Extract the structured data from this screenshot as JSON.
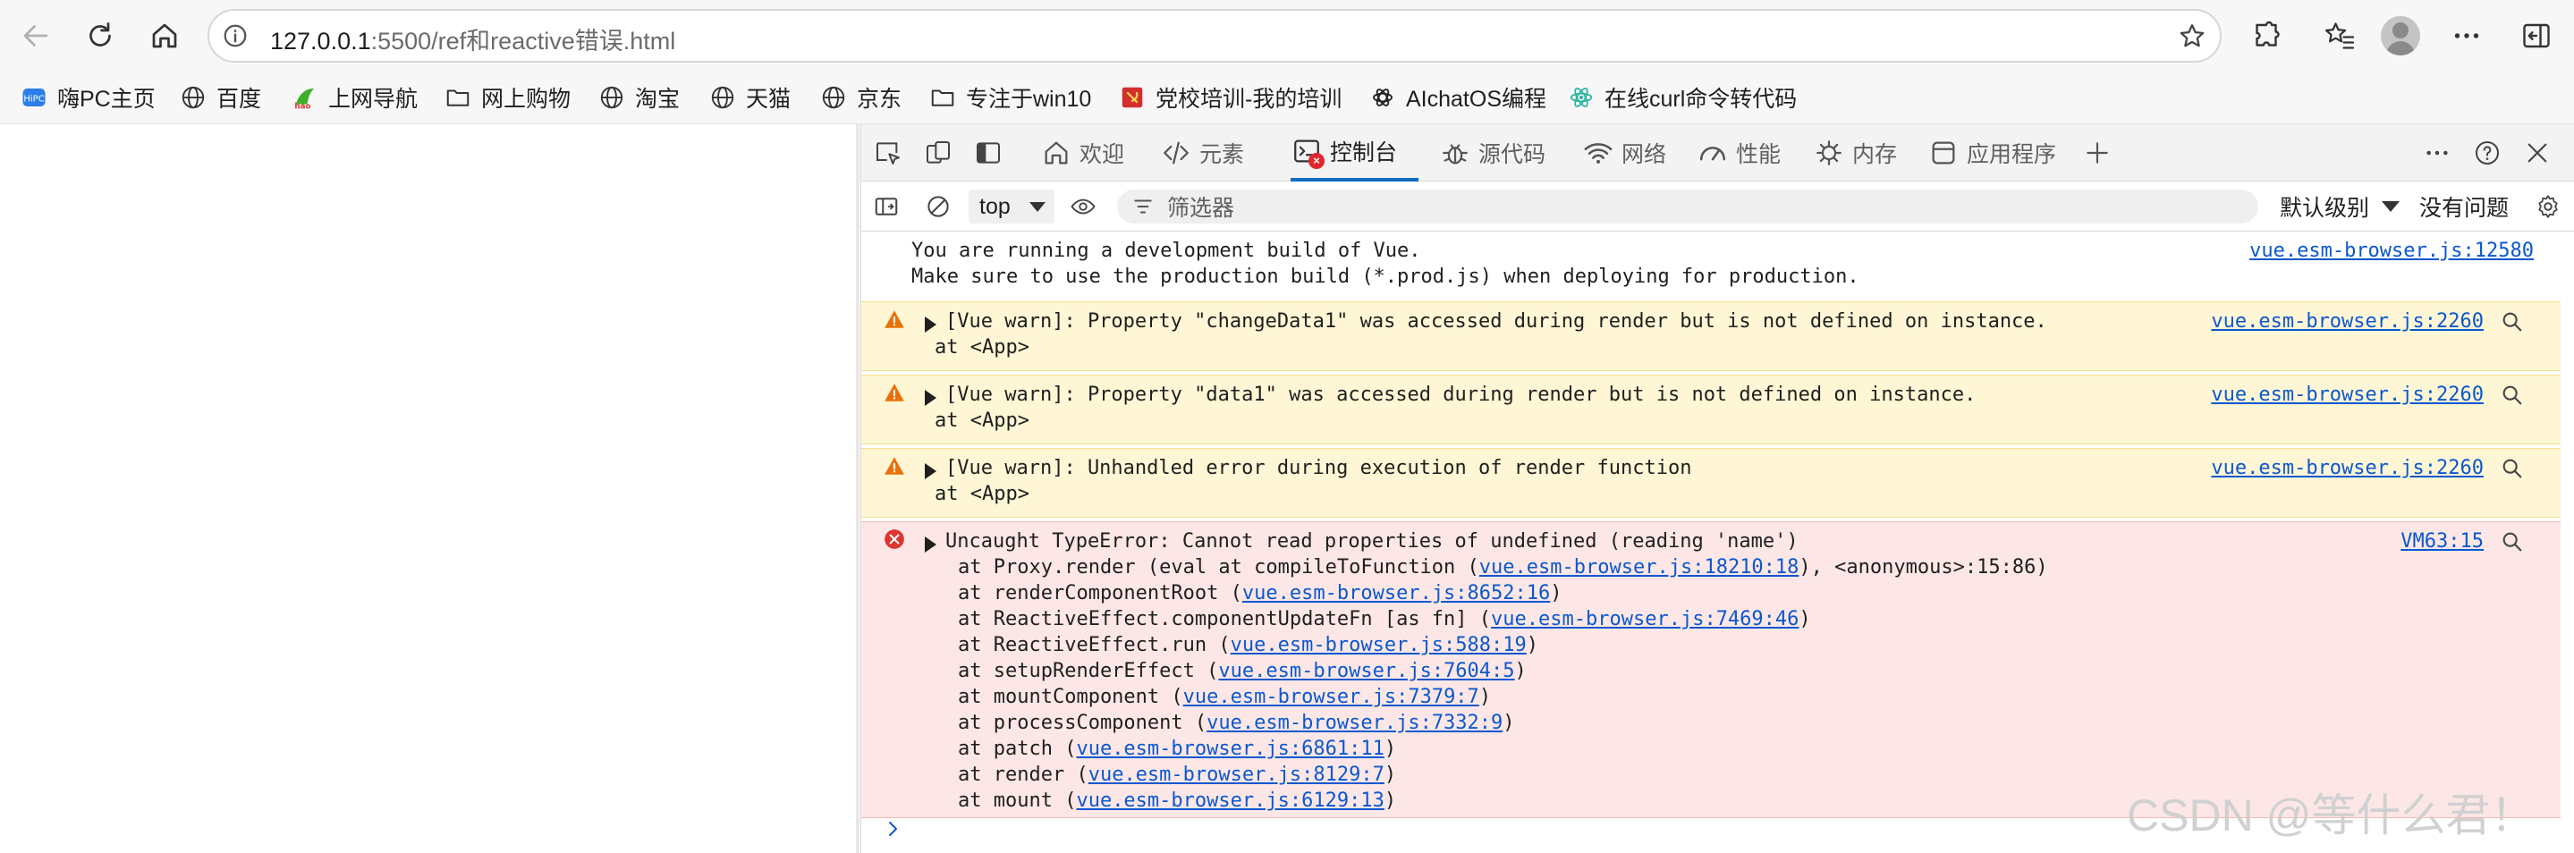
{
  "browser": {
    "url_host": "127.0.0.1",
    "url_rest": ":5500/ref和reactive错误.html"
  },
  "bookmarks": [
    {
      "label": "嗨PC主页",
      "icon": "hipc-logo-icon"
    },
    {
      "label": "百度",
      "icon": "globe-icon"
    },
    {
      "label": "上网导航",
      "icon": "hao-logo-icon"
    },
    {
      "label": "网上购物",
      "icon": "folder-icon"
    },
    {
      "label": "淘宝",
      "icon": "globe-icon"
    },
    {
      "label": "天猫",
      "icon": "globe-icon"
    },
    {
      "label": "京东",
      "icon": "globe-icon"
    },
    {
      "label": "专注于win10",
      "icon": "folder-icon"
    },
    {
      "label": "党校培训-我的培训",
      "icon": "party-emblem-icon"
    },
    {
      "label": "AIchatOS编程",
      "icon": "openai-icon"
    },
    {
      "label": "在线curl命令转代码",
      "icon": "react-icon"
    }
  ],
  "devtools": {
    "tabs": [
      {
        "label": "欢迎",
        "icon": "home-icon"
      },
      {
        "label": "元素",
        "icon": "code-icon"
      },
      {
        "label": "控制台",
        "icon": "console-icon",
        "active": true,
        "badge": "×"
      },
      {
        "label": "源代码",
        "icon": "bug-icon"
      },
      {
        "label": "网络",
        "icon": "wifi-icon"
      },
      {
        "label": "性能",
        "icon": "performance-icon"
      },
      {
        "label": "内存",
        "icon": "memory-icon"
      },
      {
        "label": "应用程序",
        "icon": "application-icon"
      }
    ],
    "context": "top",
    "filter_placeholder": "筛选器",
    "levels": "默认级别",
    "issues": "没有问题"
  },
  "console": {
    "info": {
      "lines": [
        "You are running a development build of Vue.",
        "Make sure to use the production build (*.prod.js) when deploying for production."
      ],
      "source": "vue.esm-browser.js:12580"
    },
    "warnings": [
      {
        "text": "[Vue warn]: Property \"changeData1\" was accessed during render but is not defined on instance.",
        "at": "at <App>",
        "source": "vue.esm-browser.js:2260"
      },
      {
        "text": "[Vue warn]: Property \"data1\" was accessed during render but is not defined on instance.",
        "at": "at <App>",
        "source": "vue.esm-browser.js:2260"
      },
      {
        "text": "[Vue warn]: Unhandled error during execution of render function",
        "at": "at <App>",
        "source": "vue.esm-browser.js:2260"
      }
    ],
    "error": {
      "text": "Uncaught TypeError: Cannot read properties of undefined (reading 'name')",
      "source": "VM63:15",
      "stack": [
        {
          "prefix": "at Proxy.render (eval at compileToFunction (",
          "link": "vue.esm-browser.js:18210:18",
          "suffix": "), <anonymous>:15:86)"
        },
        {
          "prefix": "at renderComponentRoot (",
          "link": "vue.esm-browser.js:8652:16",
          "suffix": ")"
        },
        {
          "prefix": "at ReactiveEffect.componentUpdateFn [as fn] (",
          "link": "vue.esm-browser.js:7469:46",
          "suffix": ")"
        },
        {
          "prefix": "at ReactiveEffect.run (",
          "link": "vue.esm-browser.js:588:19",
          "suffix": ")"
        },
        {
          "prefix": "at setupRenderEffect (",
          "link": "vue.esm-browser.js:7604:5",
          "suffix": ")"
        },
        {
          "prefix": "at mountComponent (",
          "link": "vue.esm-browser.js:7379:7",
          "suffix": ")"
        },
        {
          "prefix": "at processComponent (",
          "link": "vue.esm-browser.js:7332:9",
          "suffix": ")"
        },
        {
          "prefix": "at patch (",
          "link": "vue.esm-browser.js:6861:11",
          "suffix": ")"
        },
        {
          "prefix": "at render (",
          "link": "vue.esm-browser.js:8129:7",
          "suffix": ")"
        },
        {
          "prefix": "at mount (",
          "link": "vue.esm-browser.js:6129:13",
          "suffix": ")"
        }
      ]
    }
  },
  "watermark": "CSDN @等什么君！",
  "colors": {
    "accent": "#0f6cbd",
    "warning_bg": "#fef6d5",
    "error_bg": "#fce7e6",
    "link": "#0b57d0"
  }
}
